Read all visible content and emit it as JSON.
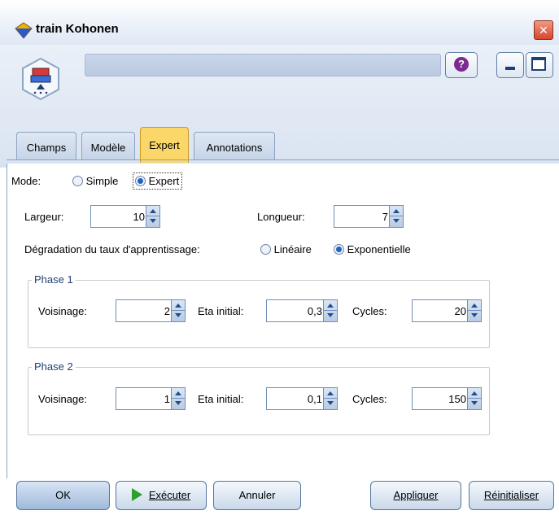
{
  "window": {
    "title": "train Kohonen"
  },
  "toolbar": {
    "help_glyph": "?"
  },
  "tabs": [
    {
      "label": "Champs"
    },
    {
      "label": "Modèle"
    },
    {
      "label": "Expert"
    },
    {
      "label": "Annotations"
    }
  ],
  "mode": {
    "label": "Mode:",
    "options": [
      "Simple",
      "Expert"
    ],
    "selected": "Expert"
  },
  "largeur": {
    "label": "Largeur:",
    "value": "10"
  },
  "longueur": {
    "label": "Longueur:",
    "value": "7"
  },
  "decay": {
    "label": "Dégradation du taux d'apprentissage:",
    "options": [
      "Linéaire",
      "Exponentielle"
    ],
    "selected": "Exponentielle"
  },
  "phase1": {
    "title": "Phase 1",
    "voisinage_label": "Voisinage:",
    "voisinage": "2",
    "eta_label": "Eta initial:",
    "eta": "0,3",
    "cycles_label": "Cycles:",
    "cycles": "20"
  },
  "phase2": {
    "title": "Phase 2",
    "voisinage_label": "Voisinage:",
    "voisinage": "1",
    "eta_label": "Eta initial:",
    "eta": "0,1",
    "cycles_label": "Cycles:",
    "cycles": "150"
  },
  "buttons": {
    "ok": "OK",
    "execute": "Exécuter",
    "cancel": "Annuler",
    "apply": "Appliquer",
    "reset": "Réinitialiser"
  },
  "colors": {
    "active_tab": "#fbd76a",
    "accent": "#1c62c8",
    "close": "#d4472c"
  }
}
